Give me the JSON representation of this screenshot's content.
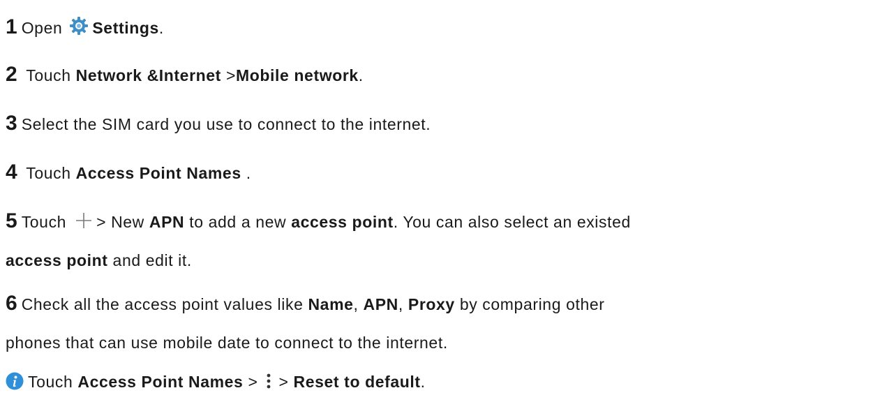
{
  "steps": [
    {
      "number": "1",
      "open": "Open",
      "settings": "Settings",
      "end": "."
    },
    {
      "number": "2",
      "touch": "Touch",
      "network": "Network &Internet",
      "sep": ">",
      "mobile": "Mobile network",
      "end": "."
    },
    {
      "number": "3",
      "text": "Select the SIM card you use to connect to the internet."
    },
    {
      "number": "4",
      "touch": "Touch",
      "apn_names": "Access Point Names",
      "end": "."
    },
    {
      "number": "5",
      "touch": "Touch",
      "new": "> New",
      "apn": "APN",
      "to_add": "to add a new",
      "access_point": "access point",
      "rest": ". You can also select an existed",
      "access_point_2": "access point",
      "and_edit": "and edit it."
    },
    {
      "number": "6",
      "check": "Check all the access point values like",
      "name": "Name",
      "comma1": ",",
      "apn": "APN",
      "comma2": ",",
      "proxy": "Proxy",
      "by_comparing": "by comparing other",
      "line2": "phones that can use mobile date to connect to the internet."
    }
  ],
  "tip": {
    "touch": "Touch",
    "apn_names": "Access Point Names",
    "sep1": ">",
    "sep2": ">",
    "reset": "Reset to default",
    "end": "."
  },
  "icons": {
    "settings": "gear-icon",
    "add": "plus-icon",
    "more": "kebab-menu-icon",
    "tip": "info-icon",
    "gear_color": "#3d8fc6",
    "info_color": "#2f8fd8"
  }
}
